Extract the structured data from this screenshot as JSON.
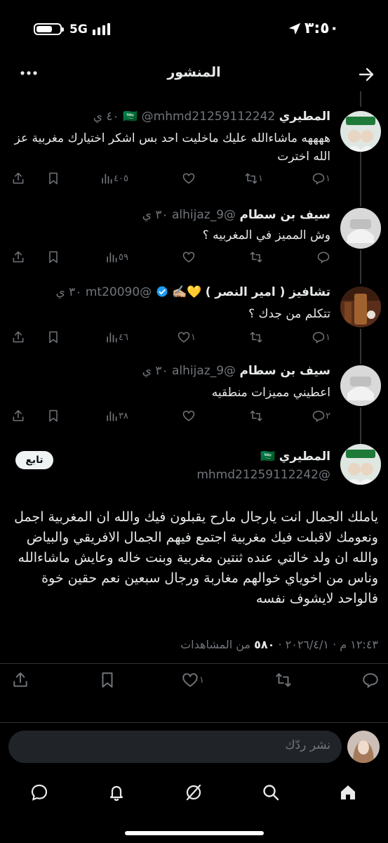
{
  "status_bar": {
    "time": "٣:٥٠",
    "network": "5G"
  },
  "header": {
    "title": "المنشور"
  },
  "replies": [
    {
      "name": "المطيري",
      "flag": "🇸🇦",
      "handle": "@mhmd21259112242",
      "time": "٤٠ ي",
      "text": "ههههه ماشاءالله عليك ماخليت احد بس اشكر اختيارك مغربية عز الله اخترت",
      "replies": "١",
      "retweets": "١",
      "likes": "",
      "views": "٤٠٥"
    },
    {
      "name": "سيف بن سطام",
      "flag": "",
      "handle": "@alhijaz_9",
      "time": "٣٠ ي",
      "text": "وش المميز في المغربيه ؟",
      "replies": "",
      "retweets": "",
      "likes": "",
      "views": "٥٩"
    },
    {
      "name": "تشافيز ( امير النصر )",
      "flag": "💛✍🏼",
      "handle": "@mt20090",
      "time": "٣٠ ي",
      "text": "تتكلم من جدك ؟",
      "replies": "١",
      "retweets": "",
      "likes": "١",
      "views": "٤٦"
    },
    {
      "name": "سيف بن سطام",
      "flag": "",
      "handle": "@alhijaz_9",
      "time": "٣٠ ي",
      "text": "اعطيني مميزات منطقيه",
      "replies": "٢",
      "retweets": "",
      "likes": "",
      "views": "٣٨"
    }
  ],
  "main_post": {
    "name": "المطيري",
    "flag": "🇸🇦",
    "handle": "@mhmd21259112242",
    "follow_label": "تابع",
    "text": "ياملك الجمال انت يارجال مارح يقبلون فيك والله ان المغربية اجمل ونعومك لاقبلت فيك مغربية اجتمع فيهم الجمال الافريقي والبياض والله ان ولد خالتي عنده ثنتين مغربية وبنت خاله وعايش ماشاءالله وناس من اخوياي خوالهم مغاربة ورجال سبعين نعم حقين خوة فالواحد لايشوف نفسه",
    "timestamp": "١٢:٤٣ م · ٢٠٢٦/٤/١ · ",
    "views_count": "٥٨٠",
    "views_label": " من المشاهدات",
    "likes": "١"
  },
  "reply_bar": {
    "placeholder": "نشر ردّك"
  },
  "icons": {
    "reply": "reply-icon",
    "retweet": "retweet-icon",
    "like": "heart-icon",
    "views": "views-icon",
    "bookmark": "bookmark-icon",
    "share": "share-icon"
  },
  "colors": {
    "background": "#000000",
    "text": "#e7e9ea",
    "muted": "#71767b",
    "verified": "#1d9bf0"
  }
}
